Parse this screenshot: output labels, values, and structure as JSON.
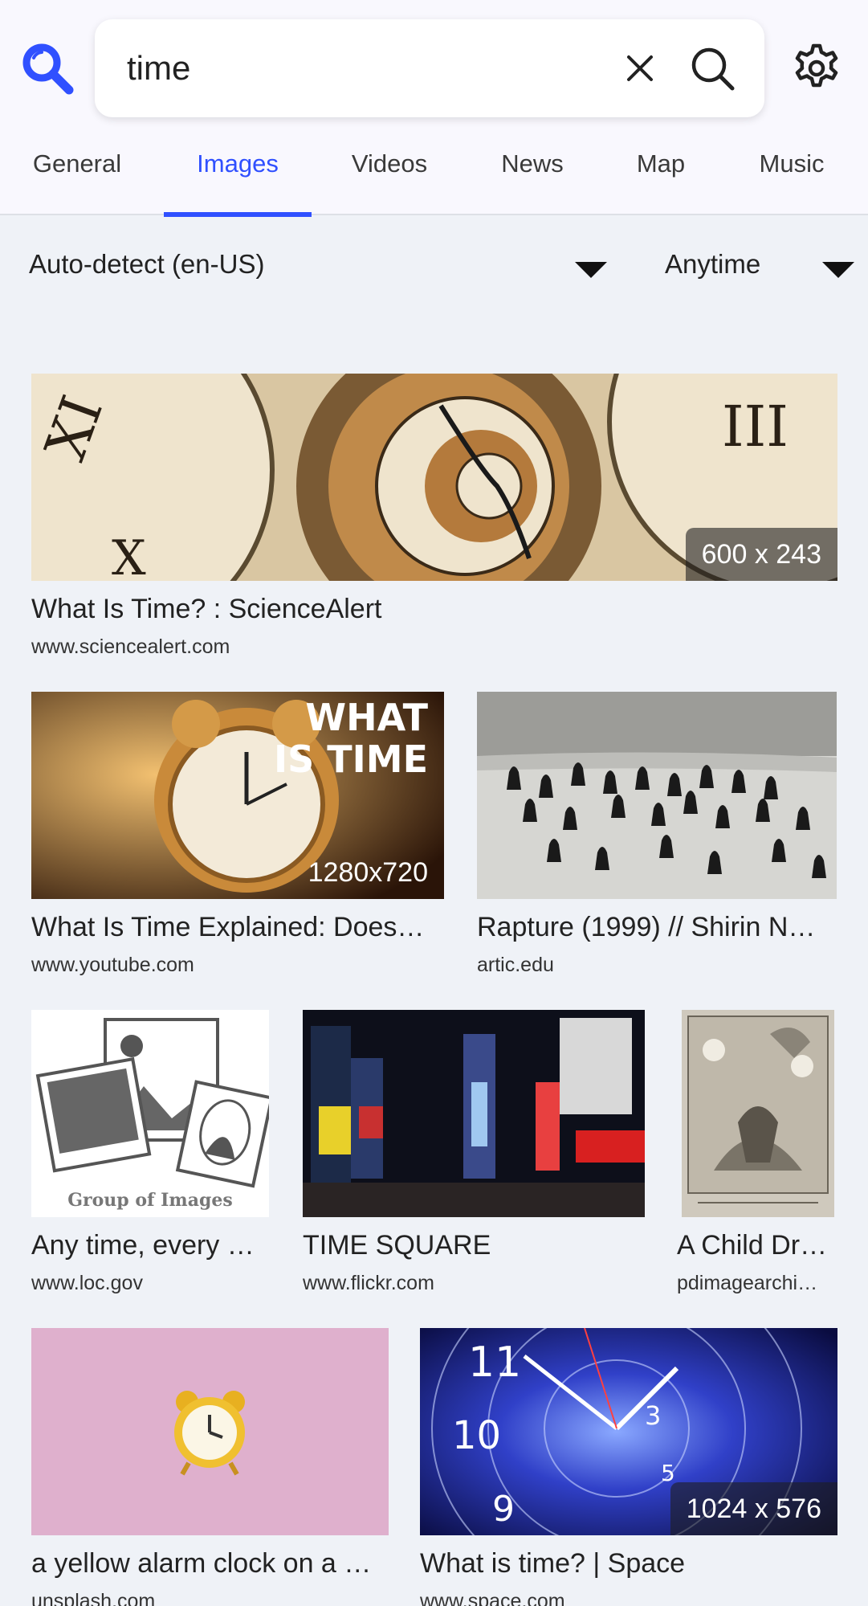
{
  "search": {
    "query": "time"
  },
  "icons": {
    "logo": "search-logo-icon",
    "clear": "close-icon",
    "search": "search-icon",
    "settings": "gear-icon"
  },
  "colors": {
    "accent": "#3050ff",
    "background": "#eff2f7"
  },
  "tabs": [
    {
      "label": "General"
    },
    {
      "label": "Images",
      "active": true
    },
    {
      "label": "Videos"
    },
    {
      "label": "News"
    },
    {
      "label": "Map"
    },
    {
      "label": "Music"
    }
  ],
  "filters": {
    "language": "Auto-detect (en-US)",
    "time": "Anytime"
  },
  "results": [
    {
      "title": "What Is Time? : ScienceAlert",
      "site": "www.sciencealert.com",
      "resolution": "600 x 243"
    },
    {
      "title": "What Is Time Explained: Does…",
      "site": "www.youtube.com",
      "resolution": "1280x720",
      "overlay_text": "WHAT IS TIME"
    },
    {
      "title": "Rapture (1999) // Shirin N…",
      "site": "artic.edu"
    },
    {
      "title": "Any time, every …",
      "site": "www.loc.gov",
      "overlay_text": "Group of Images"
    },
    {
      "title": "TIME SQUARE",
      "site": "www.flickr.com"
    },
    {
      "title": "A Child Dr…",
      "site": "pdimagearchi…"
    },
    {
      "title": "a yellow alarm clock on a …",
      "site": "unsplash.com"
    },
    {
      "title": "What is time? | Space",
      "site": "www.space.com",
      "resolution": "1024 x 576"
    }
  ]
}
